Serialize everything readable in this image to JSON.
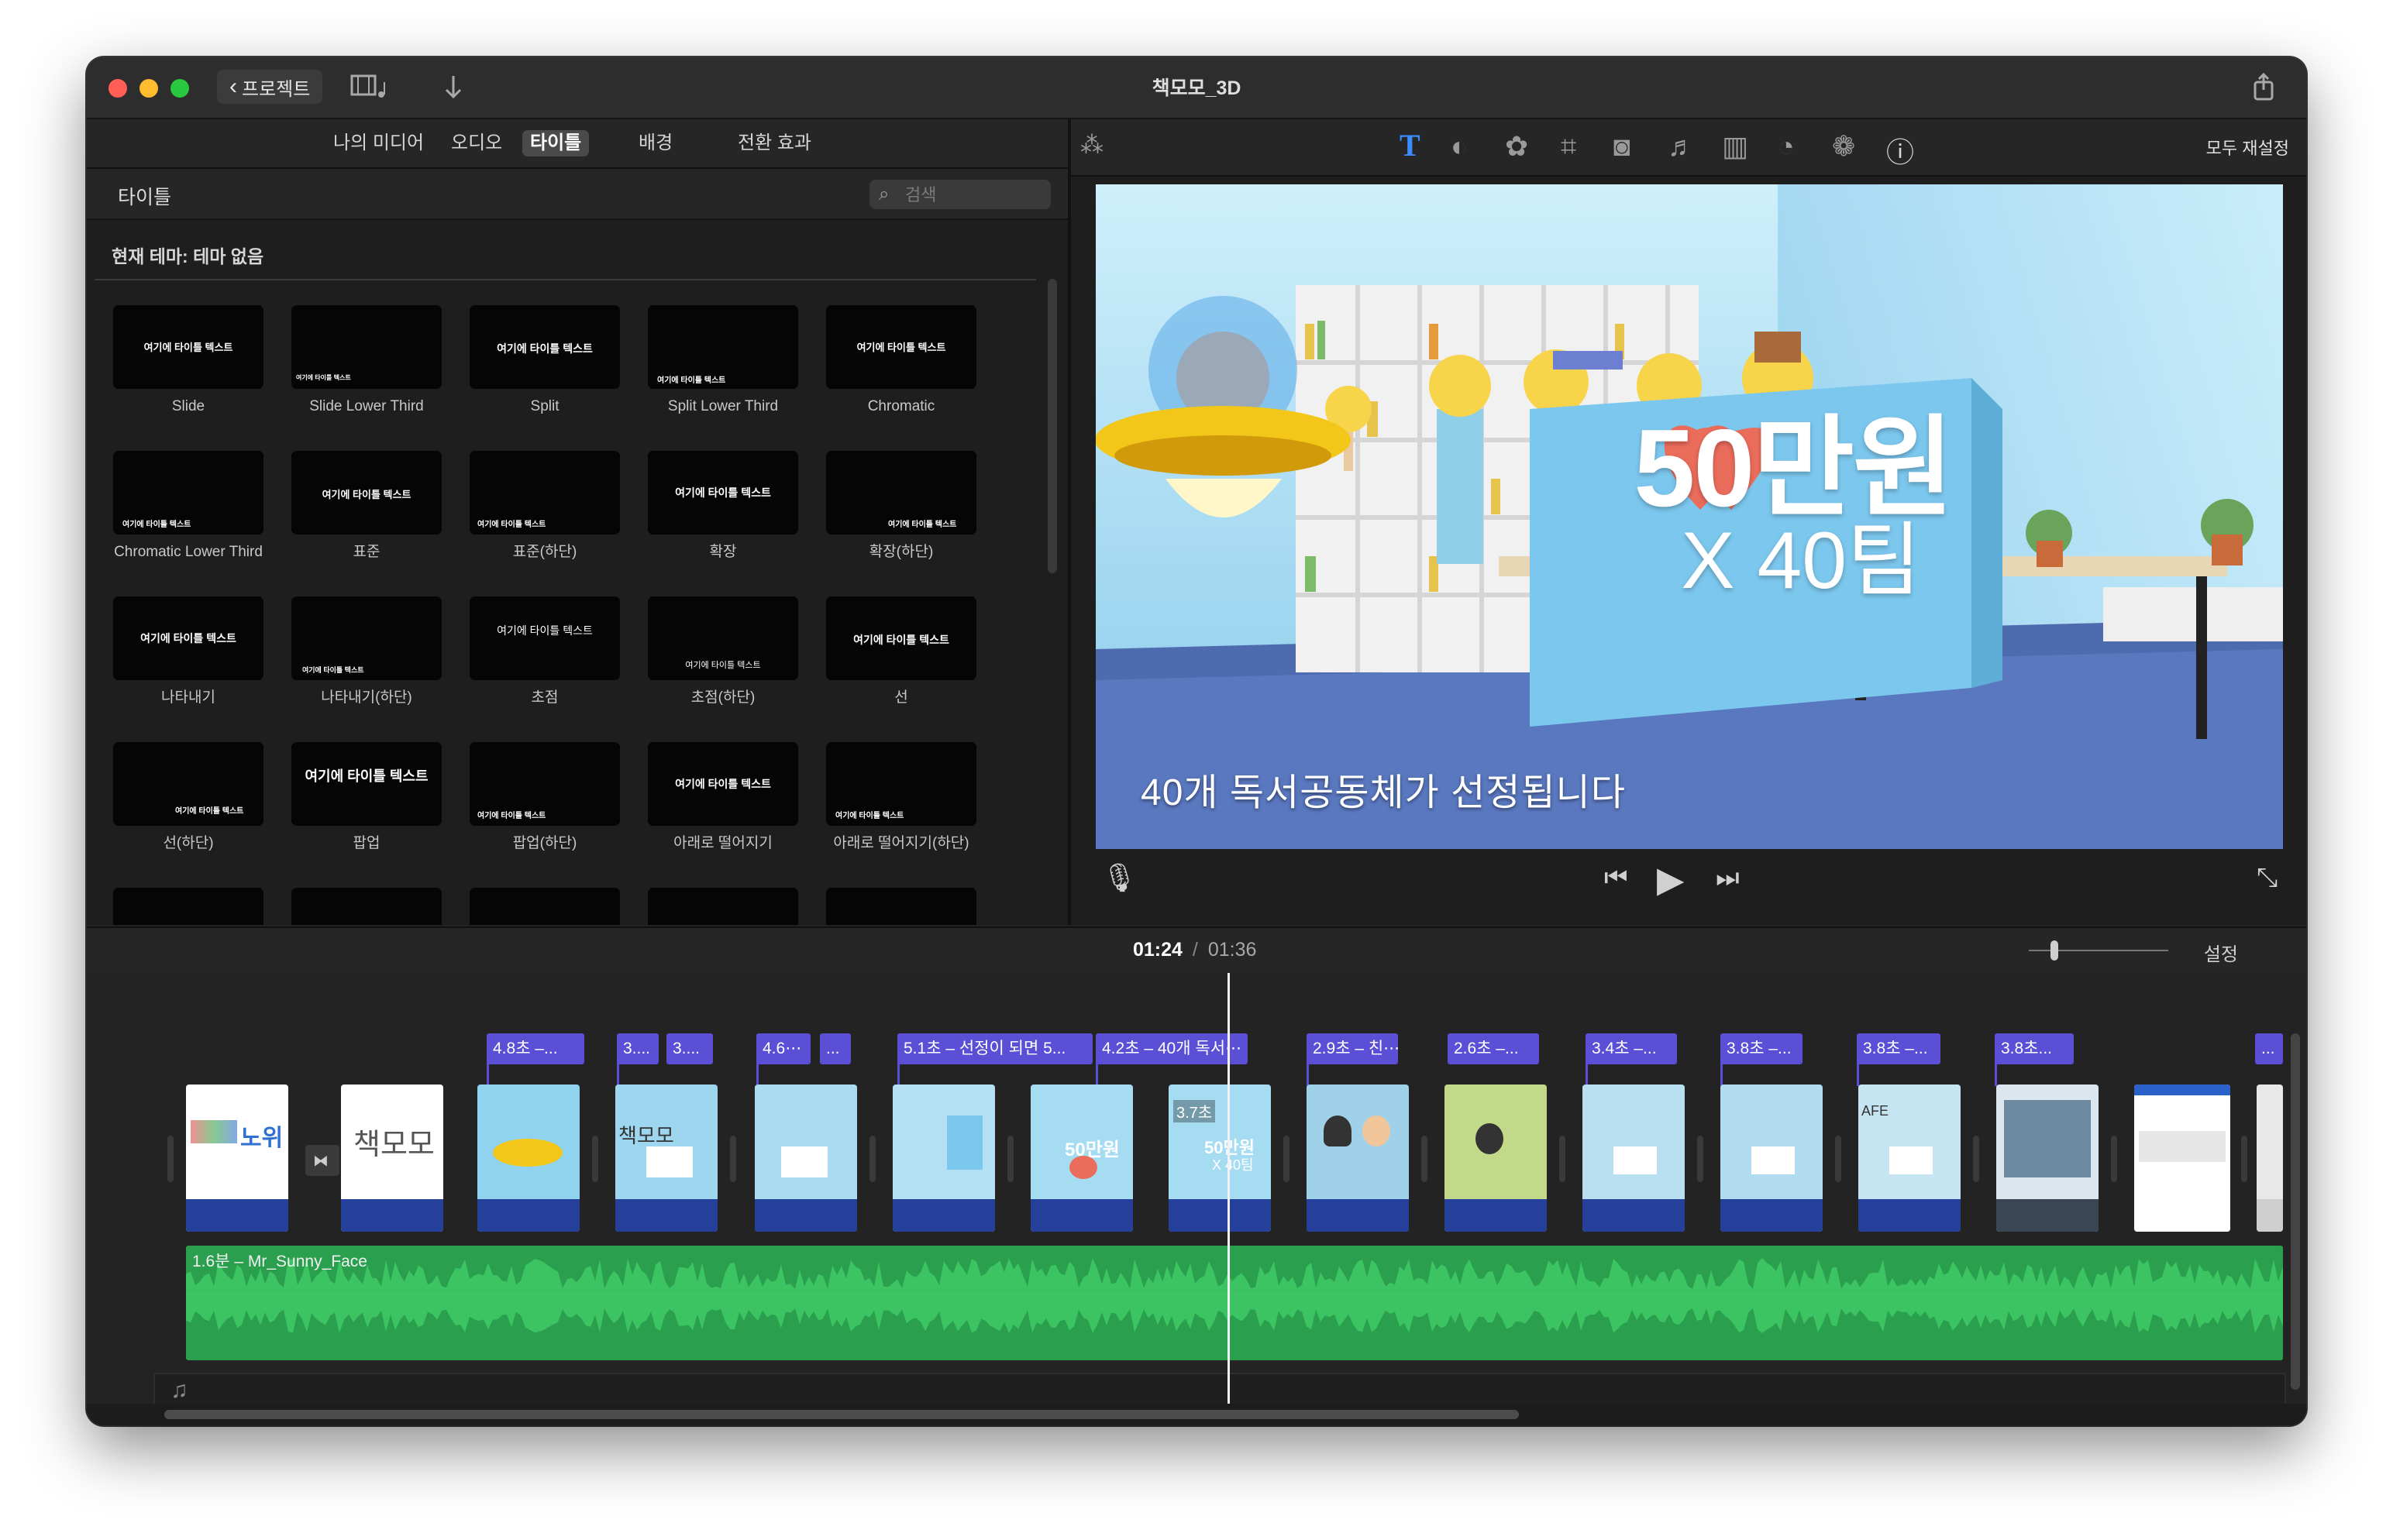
{
  "window": {
    "title": "책모모_3D"
  },
  "toolbar": {
    "back_label": "프로젝트"
  },
  "browser": {
    "tabs": [
      "나의 미디어",
      "오디오",
      "타이틀",
      "배경",
      "전환 효과"
    ],
    "active_tab": "타이틀",
    "section_title": "타이틀",
    "search_placeholder": "검색",
    "theme_label": "현재 테마: 테마 없음",
    "titles": [
      {
        "name": "Slide",
        "thumb_text": "여기에 타이틀 텍스트"
      },
      {
        "name": "Slide Lower Third",
        "thumb_text": "여기에 타이틀 텍스트"
      },
      {
        "name": "Split",
        "thumb_text": "여기에 타이틀 텍스트"
      },
      {
        "name": "Split Lower Third",
        "thumb_text": "여기에 타이틀 텍스트"
      },
      {
        "name": "Chromatic",
        "thumb_text": "여기에 타이틀 텍스트"
      },
      {
        "name": "Chromatic Lower Third",
        "thumb_text": "여기에 타이틀 텍스트"
      },
      {
        "name": "표준",
        "thumb_text": "여기에 타이틀 텍스트"
      },
      {
        "name": "표준(하단)",
        "thumb_text": "여기에 타이틀 텍스트"
      },
      {
        "name": "확장",
        "thumb_text": "여기에 타이틀 텍스트"
      },
      {
        "name": "확장(하단)",
        "thumb_text": "여기에 타이틀 텍스트"
      },
      {
        "name": "나타내기",
        "thumb_text": "여기에 타이틀 텍스트"
      },
      {
        "name": "나타내기(하단)",
        "thumb_text": "여기에 타이틀 텍스트"
      },
      {
        "name": "초점",
        "thumb_text": "여기에 타이틀 텍스트"
      },
      {
        "name": "초점(하단)",
        "thumb_text": "여기에 타이틀 텍스트"
      },
      {
        "name": "선",
        "thumb_text": "여기에 타이틀 텍스트"
      },
      {
        "name": "선(하단)",
        "thumb_text": "여기에 타이틀 텍스트"
      },
      {
        "name": "팝업",
        "thumb_text": "여기에 타이틀 텍스트"
      },
      {
        "name": "팝업(하단)",
        "thumb_text": "여기에 타이틀 텍스트"
      },
      {
        "name": "아래로 떨어지기",
        "thumb_text": "여기에 타이틀 텍스트"
      },
      {
        "name": "아래로 떨어지기(하단)",
        "thumb_text": "여기에 타이틀 텍스트"
      }
    ]
  },
  "viewer": {
    "reset_all_label": "모두 재설정",
    "frame_text": {
      "amount": "50만원",
      "teams": "X 40팀",
      "subtitle": "40개 독서공동체가 선정됩니다"
    }
  },
  "timeline": {
    "current_time": "01:24",
    "separator": "/",
    "total_time": "01:36",
    "settings_label": "설정",
    "title_labels": [
      "4.8초 –...",
      "3....",
      "3....",
      "4.6⋯",
      "...",
      "5.1초 – 선정이 되면 5...",
      "4.2초 – 40개 독서⋯",
      "2.9초 – 친⋯",
      "2.6초 –...",
      "3.4초 –...",
      "3.8초 –...",
      "3.8초 –...",
      "3.8초...",
      "..."
    ],
    "clip_overlays": {
      "clip1": "노위",
      "clip2": "책모모",
      "clip4": "책모모",
      "clip8_time": "3.7초",
      "clip7_text": "50만원",
      "clip8_text1": "50만원",
      "clip8_text2": "X 40팀",
      "clip14_text": "AFE"
    },
    "audio": {
      "label": "1.6분 – Mr_Sunny_Face"
    }
  },
  "colors": {
    "title_clip": "#5b4fd6",
    "audio_track": "#2aa04e",
    "video_clip_base": "#24409a",
    "viewer_active_tool": "#3b8cff"
  }
}
